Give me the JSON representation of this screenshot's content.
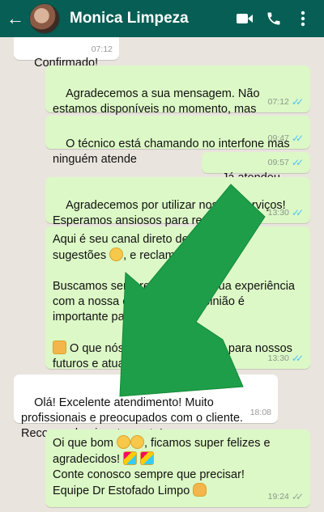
{
  "header": {
    "back_icon": "arrow-left-icon",
    "contact_name": "Monica Limpeza",
    "video_icon": "video-call-icon",
    "phone_icon": "phone-icon",
    "menu_icon": "more-vert-icon",
    "color": "#075e54"
  },
  "colors": {
    "outgoing": "#dcf8c6",
    "incoming": "#ffffff",
    "arrow": "#1e9e48",
    "read_ticks": "#4fc3f7"
  },
  "messages": [
    {
      "text": "Confirmado!",
      "time": "07:12"
    },
    {
      "text": "Agradecemos a sua mensagem. Não estamos disponíveis no momento, mas responderemos assim que possível.",
      "time": "07:12"
    },
    {
      "text": "O técnico está chamando no interfone mas ninguém atende",
      "time": "09:47"
    },
    {
      "text": "Já atendeu",
      "time": "09:57"
    },
    {
      "text": "Agradecemos por utilizar nossos serviços! Esperamos ansiosos para realizar mais serviços com a qualidade Dr. Estofado Limpo.",
      "time": "13:30"
    },
    {
      "line1": "Aqui é seu canal direto de elogios",
      "line2a": "sugestões",
      "line2b": ", e reclamações.",
      "line3": "Buscamos sempre melhorar a sua experiência com a nossa empresa, sua opinião é importante para nós!",
      "line4": "O que nós podemos melhorar para nossos futuros e atuais clientes?",
      "time": "13:30"
    },
    {
      "text": "Olá! Excelente atendimento! Muito profissionais e preocupados com o cliente. Recomendarei certamente!",
      "time": "18:08"
    },
    {
      "line1a": "Oi que bom",
      "line1b": ", ficamos super felizes e agradecidos!",
      "line2": "Conte conosco sempre que precisar!",
      "line3": "Equipe Dr Estofado Limpo",
      "time": "19:24"
    }
  ]
}
